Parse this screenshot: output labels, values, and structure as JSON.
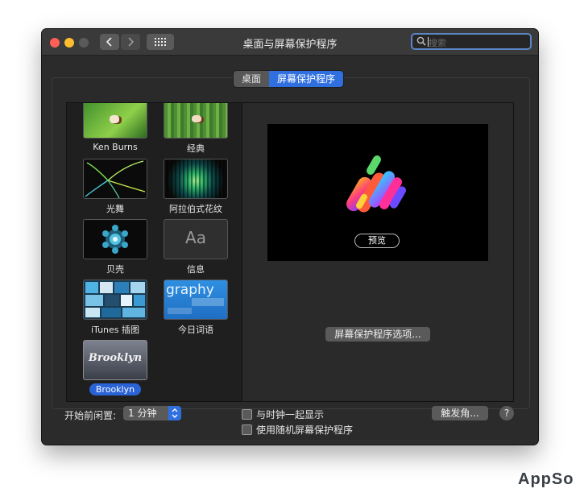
{
  "window": {
    "title": "桌面与屏幕保护程序"
  },
  "search": {
    "placeholder": "搜索"
  },
  "tabs": [
    {
      "label": "桌面",
      "active": false
    },
    {
      "label": "屏幕保护程序",
      "active": true
    }
  ],
  "savers": [
    {
      "label": "Ken Burns"
    },
    {
      "label": "经典"
    },
    {
      "label": "光舞"
    },
    {
      "label": "阿拉伯式花纹"
    },
    {
      "label": "贝壳"
    },
    {
      "label": "信息"
    },
    {
      "label": "iTunes 插图"
    },
    {
      "label": "今日词语"
    },
    {
      "label": "Brooklyn",
      "selected": true
    }
  ],
  "thumbs": {
    "message_text": "Aa",
    "word_text": "graphy",
    "brooklyn_text": "Brooklyn"
  },
  "preview": {
    "button_label": "预览",
    "options_label": "屏幕保护程序选项..."
  },
  "bottom": {
    "idle_label": "开始前闲置:",
    "idle_value": "1 分钟",
    "show_clock": "与时钟一起显示",
    "random": "使用随机屏幕保护程序",
    "hot_corners": "触发角...",
    "help": "?"
  },
  "watermark": "AppSo",
  "colors": {
    "accent": "#2f6fe0",
    "window_bg": "#2b2b2b"
  }
}
